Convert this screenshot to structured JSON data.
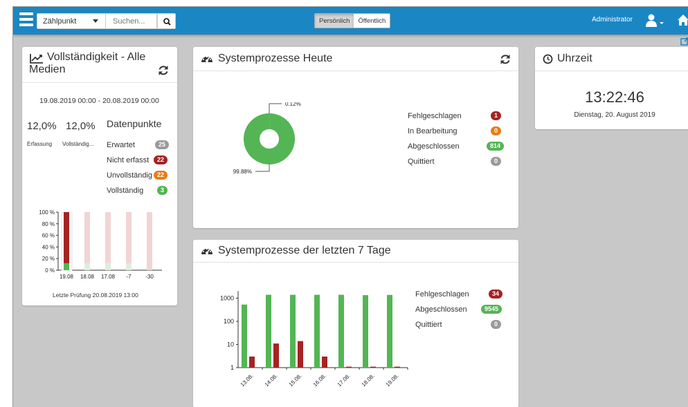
{
  "colors": {
    "accent": "#1a86c4",
    "green": "#54b554",
    "red": "#a52323",
    "orange": "#e67e18",
    "grey": "#9a9a9a",
    "pale_red": "#f2d4d4",
    "pale_green": "#dceedc"
  },
  "topbar": {
    "select_value": "Zählpunkt",
    "search_placeholder": "Suchen...",
    "toggle": [
      "Persönlich",
      "Öffentlich"
    ],
    "toggle_active": "Persönlich",
    "user": "Administrator",
    "icons": [
      "hamburger-icon",
      "search-icon",
      "user-icon",
      "home-icon",
      "external-link-icon"
    ]
  },
  "vollstaendigkeit": {
    "title_line1": "Vollständigkeit - Alle",
    "title_line2": "Medien",
    "range": "19.08.2019 00:00 - 20.08.2019 00:00",
    "erfassung_value": "12,0%",
    "erfassung_label": "Erfassung",
    "vollstaendig_value": "12,0%",
    "vollstaendig_label": "Vollständig...",
    "datenpunkte": "Datenpunkte",
    "items": [
      {
        "label": "Erwartet",
        "count": "25",
        "color": "grey"
      },
      {
        "label": "Nicht erfasst",
        "count": "22",
        "color": "red"
      },
      {
        "label": "Unvollständig",
        "count": "22",
        "color": "orange"
      },
      {
        "label": "Vollständig",
        "count": "3",
        "color": "green"
      }
    ],
    "footer": "Letzte Prüfung 20.08.2019 13:00",
    "chart_data": {
      "type": "bar",
      "stacked": true,
      "categories": [
        "19.08",
        "18.08",
        "17.08",
        "-7",
        "-30"
      ],
      "y_ticks": [
        "100 %",
        "80 %",
        "60 %",
        "40 %",
        "20 %",
        "0 %"
      ],
      "ylim": [
        0,
        100
      ],
      "series": [
        {
          "values": [
            12,
            12,
            12,
            12,
            0
          ]
        },
        {
          "values": [
            88,
            88,
            88,
            88,
            100
          ]
        }
      ]
    }
  },
  "systemprozesse_heute": {
    "title": "Systemprozesse Heute",
    "legend": [
      {
        "label": "Fehlgeschlagen",
        "count": "1",
        "color": "red"
      },
      {
        "label": "In Bearbeitung",
        "count": "0",
        "color": "orange"
      },
      {
        "label": "Abgeschlossen",
        "count": "814",
        "color": "green"
      },
      {
        "label": "Quittiert",
        "count": "0",
        "color": "grey"
      }
    ],
    "chart_data": {
      "type": "pie",
      "slices": [
        {
          "value": 0.12,
          "label": "0.12%"
        },
        {
          "value": 99.88,
          "label": "99.88%"
        }
      ]
    }
  },
  "uhrzeit": {
    "title": "Uhrzeit",
    "time": "13:22:46",
    "date": "Dienstag, 20. August 2019"
  },
  "systemprozesse_7": {
    "title": "Systemprozesse der letzten 7 Tage",
    "legend": [
      {
        "label": "Fehlgeschlagen",
        "count": "34",
        "color": "red"
      },
      {
        "label": "Abgeschlossen",
        "count": "9545",
        "color": "green"
      },
      {
        "label": "Quittiert",
        "count": "0",
        "color": "grey"
      }
    ],
    "chart_data": {
      "type": "bar",
      "yscale": "log",
      "y_ticks": [
        "1000",
        "100",
        "10",
        "1"
      ],
      "ylim": [
        1,
        2000
      ],
      "categories": [
        "13.08.",
        "14.08.",
        "15.08.",
        "16.08.",
        "17.08.",
        "18.08.",
        "19.08."
      ],
      "series": [
        {
          "values": [
            530,
            1400,
            1400,
            1400,
            1400,
            1350,
            1380
          ]
        },
        {
          "values": [
            3,
            11,
            14,
            3,
            1.1,
            1.1,
            1.1
          ]
        }
      ]
    }
  }
}
